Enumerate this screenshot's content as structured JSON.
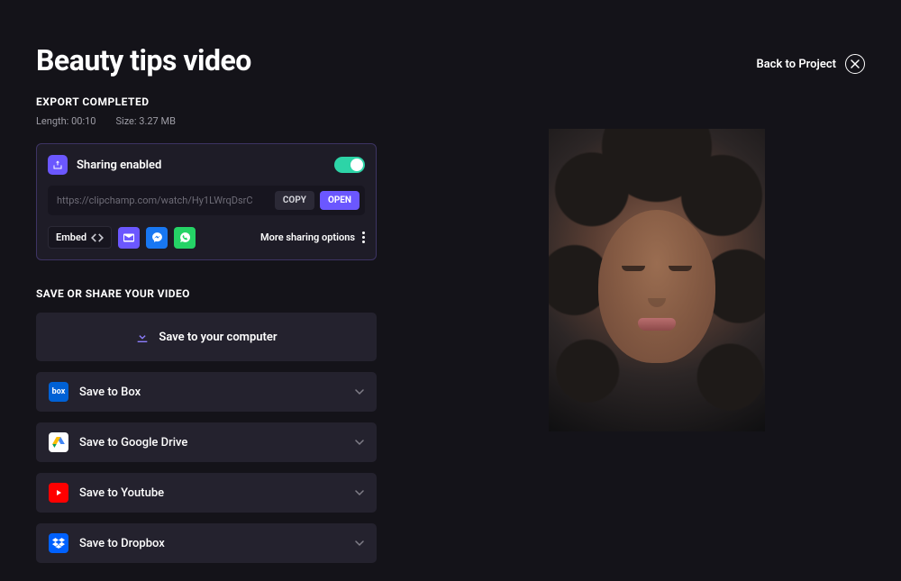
{
  "header": {
    "title": "Beauty tips video",
    "back_label": "Back to Project"
  },
  "export": {
    "status": "EXPORT COMPLETED",
    "length_label": "Length:",
    "length_value": "00:10",
    "size_label": "Size:",
    "size_value": "3.27 MB"
  },
  "sharing": {
    "enabled_label": "Sharing enabled",
    "toggle_on": true,
    "url": "https://clipchamp.com/watch/Hy1LWrqDsrC",
    "copy_label": "COPY",
    "open_label": "OPEN",
    "embed_label": "Embed",
    "more_label": "More sharing options",
    "icons": {
      "share": "share-icon",
      "code": "code-icon",
      "mail": "mail-icon",
      "messenger": "messenger-icon",
      "whatsapp": "whatsapp-icon"
    }
  },
  "save_section": {
    "title": "SAVE OR SHARE YOUR VIDEO",
    "primary_label": "Save to your computer",
    "options": [
      {
        "label": "Save to Box",
        "brand": "box"
      },
      {
        "label": "Save to Google Drive",
        "brand": "gdrive"
      },
      {
        "label": "Save to Youtube",
        "brand": "youtube"
      },
      {
        "label": "Save to Dropbox",
        "brand": "dropbox"
      }
    ]
  },
  "colors": {
    "accent": "#6b57ff",
    "toggle_on": "#2dd4a7",
    "panel": "#1e1c27",
    "row": "#24222e"
  }
}
